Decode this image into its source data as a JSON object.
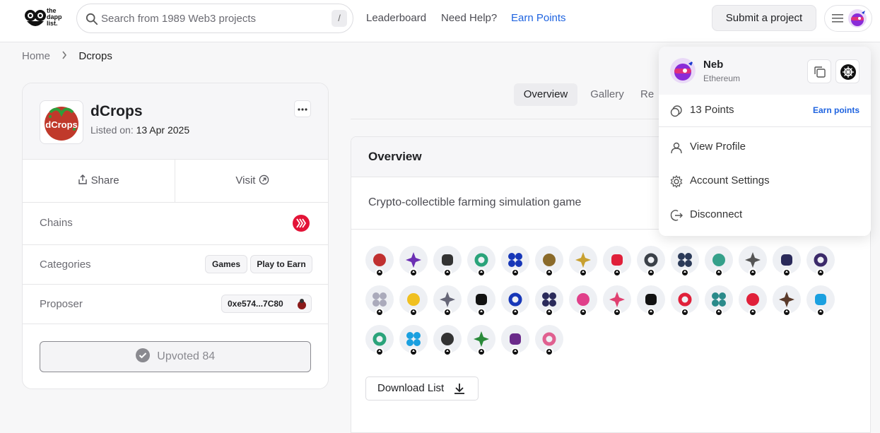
{
  "header": {
    "logo_text": [
      "the",
      "dapp",
      "list."
    ],
    "search_placeholder": "Search from 1989 Web3 projects",
    "search_shortcut": "/",
    "nav": [
      {
        "label": "Leaderboard"
      },
      {
        "label": "Need Help?"
      },
      {
        "label": "Earn Points"
      }
    ],
    "submit_label": "Submit a project"
  },
  "breadcrumb": {
    "home": "Home",
    "current": "Dcrops"
  },
  "project": {
    "name": "dCrops",
    "listed_label": "Listed on:",
    "listed_date": "13 Apr 2025",
    "share_label": "Share",
    "visit_label": "Visit",
    "chains_label": "Chains",
    "categories_label": "Categories",
    "categories": [
      "Games",
      "Play to Earn"
    ],
    "proposer_label": "Proposer",
    "proposer_address": "0xe574...7C80",
    "upvote_label": "Upvoted 84",
    "logo_text": "dCrops"
  },
  "tabs": [
    {
      "label": "Overview",
      "active": true
    },
    {
      "label": "Gallery",
      "active": false
    },
    {
      "label": "Re",
      "active": false
    }
  ],
  "overview": {
    "title": "Overview",
    "description": "Crypto-collectible farming simulation game",
    "download_label": "Download List"
  },
  "upvoters": {
    "count_shown": 35,
    "colors": [
      "#c03030",
      "#6b2fb3",
      "#333",
      "#2aa37a",
      "#1737b8",
      "#8a6a2a",
      "#c8a030",
      "#e0203a",
      "#3a4048",
      "#2b3a58",
      "#35a08a",
      "#555",
      "#2a2a5a",
      "#3b2a6a",
      "#aab",
      "#f0c020",
      "#667",
      "#111",
      "#1737b8",
      "#2a2a5a",
      "#e0408a",
      "#e04070",
      "#111",
      "#e0203a",
      "#2a8a8a",
      "#e0203a",
      "#5a3a2a",
      "#1aa0e0",
      "#2aa37a",
      "#1aa0e0",
      "#333",
      "#2a8a3a",
      "#6a2a8a",
      "#e06090"
    ]
  },
  "dropdown": {
    "user_name": "Neb",
    "network": "Ethereum",
    "points_label": "13 Points",
    "earn_label": "Earn points",
    "items": [
      {
        "label": "View Profile"
      },
      {
        "label": "Account Settings"
      },
      {
        "label": "Disconnect"
      }
    ]
  },
  "colors": {
    "accent": "#1f64e0",
    "hive_red": "#e31337"
  }
}
